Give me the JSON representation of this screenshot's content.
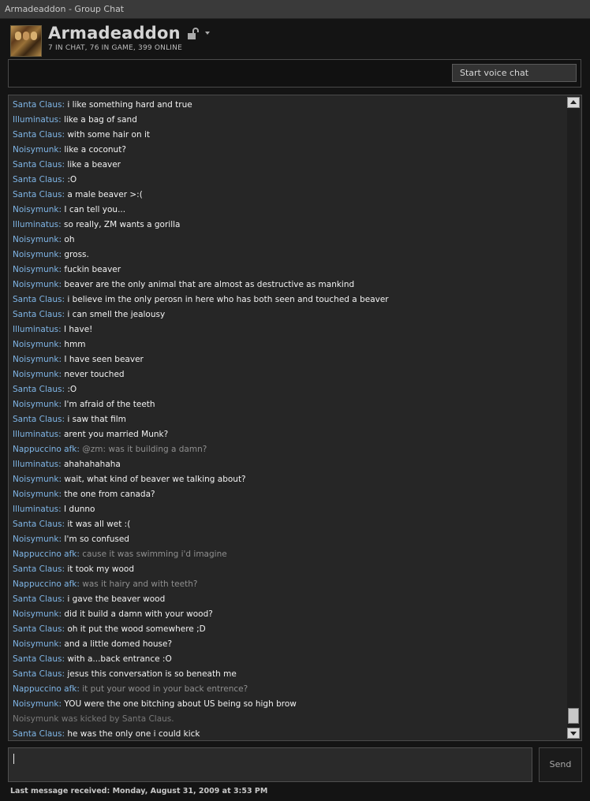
{
  "window": {
    "title": "Armadeaddon - Group Chat"
  },
  "header": {
    "group_name": "Armadeaddon",
    "stats": "7 IN CHAT, 76 IN GAME, 399 ONLINE",
    "lock_icon": "unlocked-padlock-icon",
    "dropdown_icon": "chevron-down-icon"
  },
  "voice": {
    "button_label": "Start voice chat"
  },
  "colors": {
    "sender": "#7fb5e6",
    "message": "#f2f2f2",
    "gray_message": "#8f8f8f",
    "system": "#7a7a7a",
    "background": "#141414",
    "panel": "#262626"
  },
  "messages": [
    {
      "sender": "Santa Claus",
      "text": "i like something hard and true"
    },
    {
      "sender": "Illuminatus",
      "text": "like a bag of sand"
    },
    {
      "sender": "Santa Claus",
      "text": "with some hair on it"
    },
    {
      "sender": "Noisymunk",
      "text": "like a coconut?"
    },
    {
      "sender": "Santa Claus",
      "text": "like a beaver"
    },
    {
      "sender": "Santa Claus",
      "text": ":O"
    },
    {
      "sender": "Santa Claus",
      "text": "a male beaver >:("
    },
    {
      "sender": "Noisymunk",
      "text": "I can tell you..."
    },
    {
      "sender": "Illuminatus",
      "text": "so really, ZM wants a gorilla"
    },
    {
      "sender": "Noisymunk",
      "text": "oh"
    },
    {
      "sender": "Noisymunk",
      "text": "gross."
    },
    {
      "sender": "Noisymunk",
      "text": "fuckin beaver"
    },
    {
      "sender": "Noisymunk",
      "text": "beaver are the only animal that are almost as destructive as mankind"
    },
    {
      "sender": "Santa Claus",
      "text": "i believe im the only perosn in here who has both seen and touched a beaver"
    },
    {
      "sender": "Santa Claus",
      "text": "i can smell the jealousy"
    },
    {
      "sender": "Illuminatus",
      "text": "I have!"
    },
    {
      "sender": "Noisymunk",
      "text": "hmm"
    },
    {
      "sender": "Noisymunk",
      "text": "I have seen beaver"
    },
    {
      "sender": "Noisymunk",
      "text": "never touched"
    },
    {
      "sender": "Santa Claus",
      "text": ":O"
    },
    {
      "sender": "Noisymunk",
      "text": "I'm afraid of the teeth"
    },
    {
      "sender": "Santa Claus",
      "text": "i saw that film"
    },
    {
      "sender": "Illuminatus",
      "text": "arent you married Munk?"
    },
    {
      "sender": "Nappuccino afk",
      "text": "@zm: was it building a damn?",
      "gray": true
    },
    {
      "sender": "Illuminatus",
      "text": "ahahahahaha"
    },
    {
      "sender": "Noisymunk",
      "text": "wait, what kind of beaver we talking about?"
    },
    {
      "sender": "Noisymunk",
      "text": "the one from canada?"
    },
    {
      "sender": "Illuminatus",
      "text": "I dunno"
    },
    {
      "sender": "Santa Claus",
      "text": "it was all wet :("
    },
    {
      "sender": "Noisymunk",
      "text": "I'm so confused"
    },
    {
      "sender": "Nappuccino afk",
      "text": "cause it was swimming i'd imagine",
      "gray": true
    },
    {
      "sender": "Santa Claus",
      "text": "it took my wood"
    },
    {
      "sender": "Nappuccino afk",
      "text": "was it hairy and with teeth?",
      "gray": true
    },
    {
      "sender": "Santa Claus",
      "text": "i gave the beaver wood"
    },
    {
      "sender": "Noisymunk",
      "text": "did it build a damn with your wood?"
    },
    {
      "sender": "Santa Claus",
      "text": "oh it put the wood somewhere ;D"
    },
    {
      "sender": "Noisymunk",
      "text": "and a little domed house?"
    },
    {
      "sender": "Santa Claus",
      "text": "with a...back entrance :O"
    },
    {
      "sender": "Santa Claus",
      "text": "jesus this conversation is so beneath me"
    },
    {
      "sender": "Nappuccino afk",
      "text": "it put your wood in your back entrence?",
      "gray": true
    },
    {
      "sender": "Noisymunk",
      "text": "YOU were the one bitching about US being so high brow"
    },
    {
      "system": "Noisymunk was kicked by Santa Claus."
    },
    {
      "sender": "Santa Claus",
      "text": "he was the only one i could kick"
    }
  ],
  "input": {
    "value": ""
  },
  "send": {
    "label": "Send"
  },
  "status": {
    "last_message": "Last message received: Monday, August 31, 2009 at 3:53 PM"
  },
  "scrollbar": {
    "up_icon": "scroll-up-arrow-icon",
    "down_icon": "scroll-down-arrow-icon"
  }
}
